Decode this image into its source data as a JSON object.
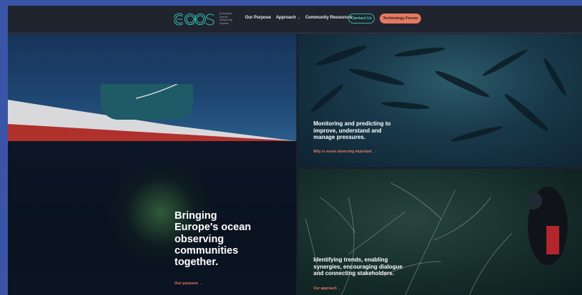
{
  "header": {
    "logo_text": "EOOS",
    "logo_tagline": [
      "European",
      "Ocean",
      "Observing",
      "System"
    ],
    "nav": [
      {
        "label": "Our Purpose",
        "has_dropdown": false
      },
      {
        "label": "Approach",
        "has_dropdown": true
      },
      {
        "label": "Community Resources",
        "has_dropdown": true
      }
    ],
    "contact_label": "Contact Us",
    "forum_label": "Technology Forum"
  },
  "hero": {
    "lines": [
      "Bringing",
      "Europe's ocean",
      "observing",
      "communities",
      "together."
    ],
    "link": "Our purpose →"
  },
  "panel_top": {
    "lines": [
      "Monitoring and predicting to",
      "improve, understand and",
      "manage pressures."
    ],
    "link": "Why is ocean observing important →"
  },
  "panel_bottom": {
    "lines": [
      "Identifying trends, enabling",
      "synergies, encouraging dialogue",
      "and connecting stakeholders."
    ],
    "link": "Our approach →"
  },
  "colors": {
    "accent": "#e47a62",
    "teal": "#2fb5a5",
    "page_bg": "#3a55a8"
  }
}
